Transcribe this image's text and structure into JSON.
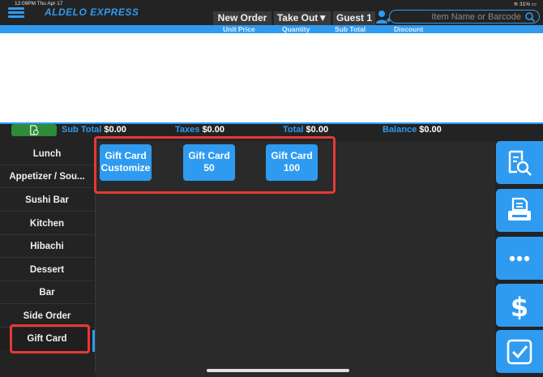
{
  "status_bar": {
    "time": "12:09PM  Thu Apr 17",
    "battery": "31%"
  },
  "header": {
    "brand": "ALDELO EXPRESS",
    "order_type_button": "New Order",
    "service_dropdown": "Take Out▼",
    "guest_button": "Guest 1",
    "search_placeholder": "Item Name or Barcode"
  },
  "columns": [
    "Unit Price",
    "Quantity",
    "Sub Total",
    "Discount"
  ],
  "totals": {
    "sub_total_label": "Sub Total",
    "sub_total_value": "$0.00",
    "taxes_label": "Taxes",
    "taxes_value": "$0.00",
    "total_label": "Total",
    "total_value": "$0.00",
    "balance_label": "Balance",
    "balance_value": "$0.00"
  },
  "categories": [
    {
      "label": "Lunch"
    },
    {
      "label": "Appetizer / Sou..."
    },
    {
      "label": "Sushi Bar"
    },
    {
      "label": "Kitchen"
    },
    {
      "label": "Hibachi"
    },
    {
      "label": "Dessert"
    },
    {
      "label": "Bar"
    },
    {
      "label": "Side Order"
    },
    {
      "label": "Gift Card"
    }
  ],
  "active_category": "Gift Card",
  "items": [
    {
      "line1": "Gift Card",
      "line2": "Customize"
    },
    {
      "line1": "Gift Card",
      "line2": "50"
    },
    {
      "line1": "Gift Card",
      "line2": "100"
    }
  ],
  "actions": [
    "search-receipt-icon",
    "print-icon",
    "more-icon",
    "payment-icon",
    "checkout-icon"
  ],
  "colors": {
    "accent": "#2f9bf0",
    "highlight": "#e53935",
    "receipt_button": "#2e8b3a",
    "background": "#232323"
  }
}
